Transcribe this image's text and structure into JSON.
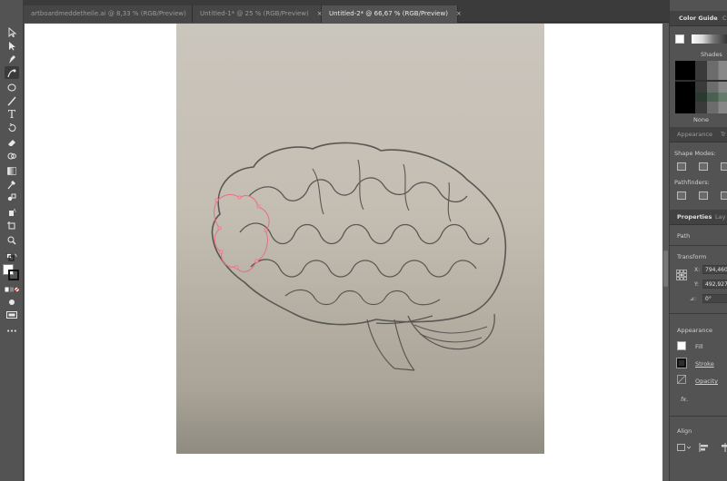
{
  "tabs": [
    {
      "label": "artboardmeddetheile.ai @ 8,33 % (RGB/Preview)",
      "close": "×"
    },
    {
      "label": "Untitled-1* @ 25 % (RGB/Preview)",
      "close": "×"
    },
    {
      "label": "Untitled-2* @ 66,67 % (RGB/Preview)",
      "close": "×"
    }
  ],
  "tools": [
    "selection",
    "direct-selection",
    "pen",
    "curvature",
    "ellipse",
    "paintbrush",
    "type",
    "rotate",
    "eraser",
    "shape-builder",
    "gradient",
    "eyedropper",
    "blend",
    "symbol-sprayer",
    "artboard",
    "zoom"
  ],
  "color_guide": {
    "tab": "Color Guide",
    "tab2": "C",
    "shades_label": "Shades",
    "none_label": "None"
  },
  "appearance_tabs": {
    "tab1": "Appearance",
    "tab2": "Tr"
  },
  "shape_modes_label": "Shape Modes:",
  "pathfinders_label": "Pathfinders:",
  "properties_tabs": {
    "tab1": "Properties",
    "tab2": "Lay"
  },
  "properties": {
    "object_type": "Path",
    "transform_label": "Transform",
    "x_label": "X:",
    "x_value": "794,460",
    "y_label": "Y:",
    "y_value": "492,927",
    "angle_label": "⊿:",
    "angle_value": "0°",
    "appearance_label": "Appearance",
    "fill_label": "Fill",
    "stroke_label": "Stroke",
    "opacity_label": "Opacity",
    "fx_label": "fx.",
    "align_label": "Align"
  },
  "colors": {
    "ui_dark": "#3b3b3b",
    "ui_mid": "#535353",
    "canvas": "#ffffff",
    "path_highlight": "#e86f7f"
  }
}
